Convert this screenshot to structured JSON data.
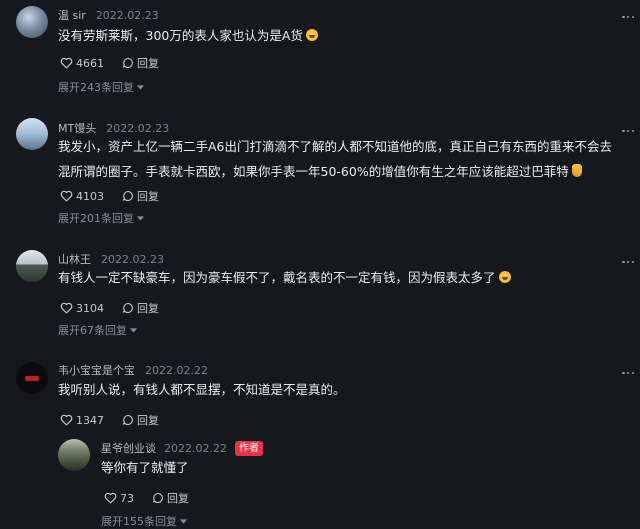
{
  "comments": [
    {
      "user": "温 sir",
      "date": "2022.02.23",
      "text": "没有劳斯莱斯，300万的表人家也认为是A货",
      "emoji": "laughing-tears-emoji",
      "likes": "4661",
      "reply_label": "回复",
      "expand": "展开243条回复"
    },
    {
      "user": "MT馒头",
      "date": "2022.02.23",
      "text": "我发小，资产上亿一辆二手A6出门打滴滴不了解的人都不知道他的底，真正自己有东西的重来不会去混所谓的圈子。手表就卡西欧，如果你手表一年50-60%的增值你有生之年应该能超过巴菲特",
      "emoji": "thumbs-up-emoji",
      "likes": "4103",
      "reply_label": "回复",
      "expand": "展开201条回复"
    },
    {
      "user": "山林王",
      "date": "2022.02.23",
      "text": "有钱人一定不缺豪车，因为豪车假不了，戴名表的不一定有钱，因为假表太多了",
      "emoji": "laughing-tears-emoji",
      "likes": "3104",
      "reply_label": "回复",
      "expand": "展开67条回复"
    },
    {
      "user": "韦小宝宝是个宝",
      "date": "2022.02.22",
      "text": "我听别人说，有钱人都不显摆，不知道是不是真的。",
      "likes": "1347",
      "reply_label": "回复",
      "reply": {
        "user": "星爷创业谈",
        "date": "2022.02.22",
        "badge": "作者",
        "text": "等你有了就懂了",
        "likes": "73",
        "reply_label": "回复"
      },
      "expand": "展开155条回复"
    }
  ],
  "colors": {
    "background": "#16181f",
    "author_badge": "#e8344a"
  }
}
